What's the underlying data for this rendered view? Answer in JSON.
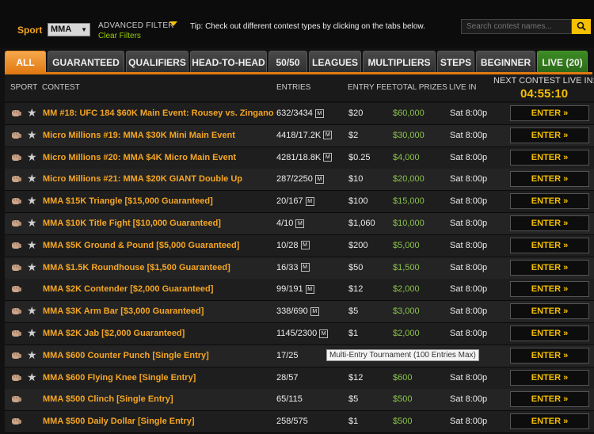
{
  "filter": {
    "sport_label": "Sport",
    "sport_value": "MMA",
    "advanced_filter": "ADVANCED FILTER",
    "clear_filters": "Clear Filters",
    "tip": "Tip: Check out different contest types by clicking on the tabs below.",
    "search_placeholder": "Search contest names..."
  },
  "tabs": [
    {
      "label": "ALL",
      "active": true
    },
    {
      "label": "GUARANTEED"
    },
    {
      "label": "QUALIFIERS"
    },
    {
      "label": "HEAD-TO-HEAD"
    },
    {
      "label": "50/50"
    },
    {
      "label": "LEAGUES"
    },
    {
      "label": "MULTIPLIERS"
    },
    {
      "label": "STEPS"
    },
    {
      "label": "BEGINNER"
    },
    {
      "label": "LIVE (20)"
    }
  ],
  "table": {
    "headers": {
      "sport": "SPORT",
      "contest": "CONTEST",
      "entries": "ENTRIES",
      "fee": "ENTRY FEE",
      "prizes": "TOTAL PRIZES",
      "live_in": "LIVE IN"
    },
    "next_live_label": "NEXT CONTEST LIVE IN:",
    "next_live_time": "04:55:10",
    "enter_label": "ENTER »",
    "rows": [
      {
        "contest": "MM #18: UFC 184 $60K Main Event: Rousey vs. Zingano",
        "entries": "632/3434",
        "multi": true,
        "fee": "$20",
        "prize": "$60,000",
        "live": "Sat 8:00p",
        "star": true
      },
      {
        "contest": "Micro Millions #19: MMA $30K Mini Main Event",
        "entries": "4418/17.2K",
        "multi": true,
        "fee": "$2",
        "prize": "$30,000",
        "live": "Sat 8:00p",
        "star": true
      },
      {
        "contest": "Micro Millions #20: MMA $4K Micro Main Event",
        "entries": "4281/18.8K",
        "multi": true,
        "fee": "$0.25",
        "prize": "$4,000",
        "live": "Sat 8:00p",
        "star": true
      },
      {
        "contest": "Micro Millions #21: MMA $20K GIANT Double Up",
        "entries": "287/2250",
        "multi": true,
        "fee": "$10",
        "prize": "$20,000",
        "live": "Sat 8:00p",
        "star": true
      },
      {
        "contest": "MMA $15K Triangle [$15,000 Guaranteed]",
        "entries": "20/167",
        "multi": true,
        "fee": "$100",
        "prize": "$15,000",
        "live": "Sat 8:00p",
        "star": true
      },
      {
        "contest": "MMA $10K Title Fight [$10,000 Guaranteed]",
        "entries": "4/10",
        "multi": true,
        "fee": "$1,060",
        "prize": "$10,000",
        "live": "Sat 8:00p",
        "star": true
      },
      {
        "contest": "MMA $5K Ground & Pound [$5,000 Guaranteed]",
        "entries": "10/28",
        "multi": true,
        "fee": "$200",
        "prize": "$5,000",
        "live": "Sat 8:00p",
        "star": true
      },
      {
        "contest": "MMA $1.5K Roundhouse [$1,500 Guaranteed]",
        "entries": "16/33",
        "multi": true,
        "fee": "$50",
        "prize": "$1,500",
        "live": "Sat 8:00p",
        "star": true
      },
      {
        "contest": "MMA $2K Contender [$2,000 Guaranteed]",
        "entries": "99/191",
        "multi": true,
        "fee": "$12",
        "prize": "$2,000",
        "live": "Sat 8:00p",
        "star": false
      },
      {
        "contest": "MMA $3K Arm Bar [$3,000 Guaranteed]",
        "entries": "338/690",
        "multi": true,
        "fee": "$5",
        "prize": "$3,000",
        "live": "Sat 8:00p",
        "star": true
      },
      {
        "contest": "MMA $2K Jab [$2,000 Guaranteed]",
        "entries": "1145/2300",
        "multi": true,
        "fee": "$1",
        "prize": "$2,000",
        "live": "Sat 8:00p",
        "star": true
      },
      {
        "contest": "MMA $600 Counter Punch [Single Entry]",
        "entries": "17/25",
        "multi": false,
        "fee": "",
        "prize": "",
        "live": ":00p",
        "star": true
      },
      {
        "contest": "MMA $600 Flying Knee [Single Entry]",
        "entries": "28/57",
        "multi": false,
        "fee": "$12",
        "prize": "$600",
        "live": "Sat 8:00p",
        "star": true
      },
      {
        "contest": "MMA $500 Clinch [Single Entry]",
        "entries": "65/115",
        "multi": false,
        "fee": "$5",
        "prize": "$500",
        "live": "Sat 8:00p",
        "star": false
      },
      {
        "contest": "MMA $500 Daily Dollar [Single Entry]",
        "entries": "258/575",
        "multi": false,
        "fee": "$1",
        "prize": "$500",
        "live": "Sat 8:00p",
        "star": false
      }
    ]
  },
  "tooltip": "Multi-Entry Tournament (100 Entries Max)",
  "colors": {
    "accent": "#f5a623",
    "prize_green": "#8bc34a",
    "enter_yellow": "#f5c000"
  }
}
